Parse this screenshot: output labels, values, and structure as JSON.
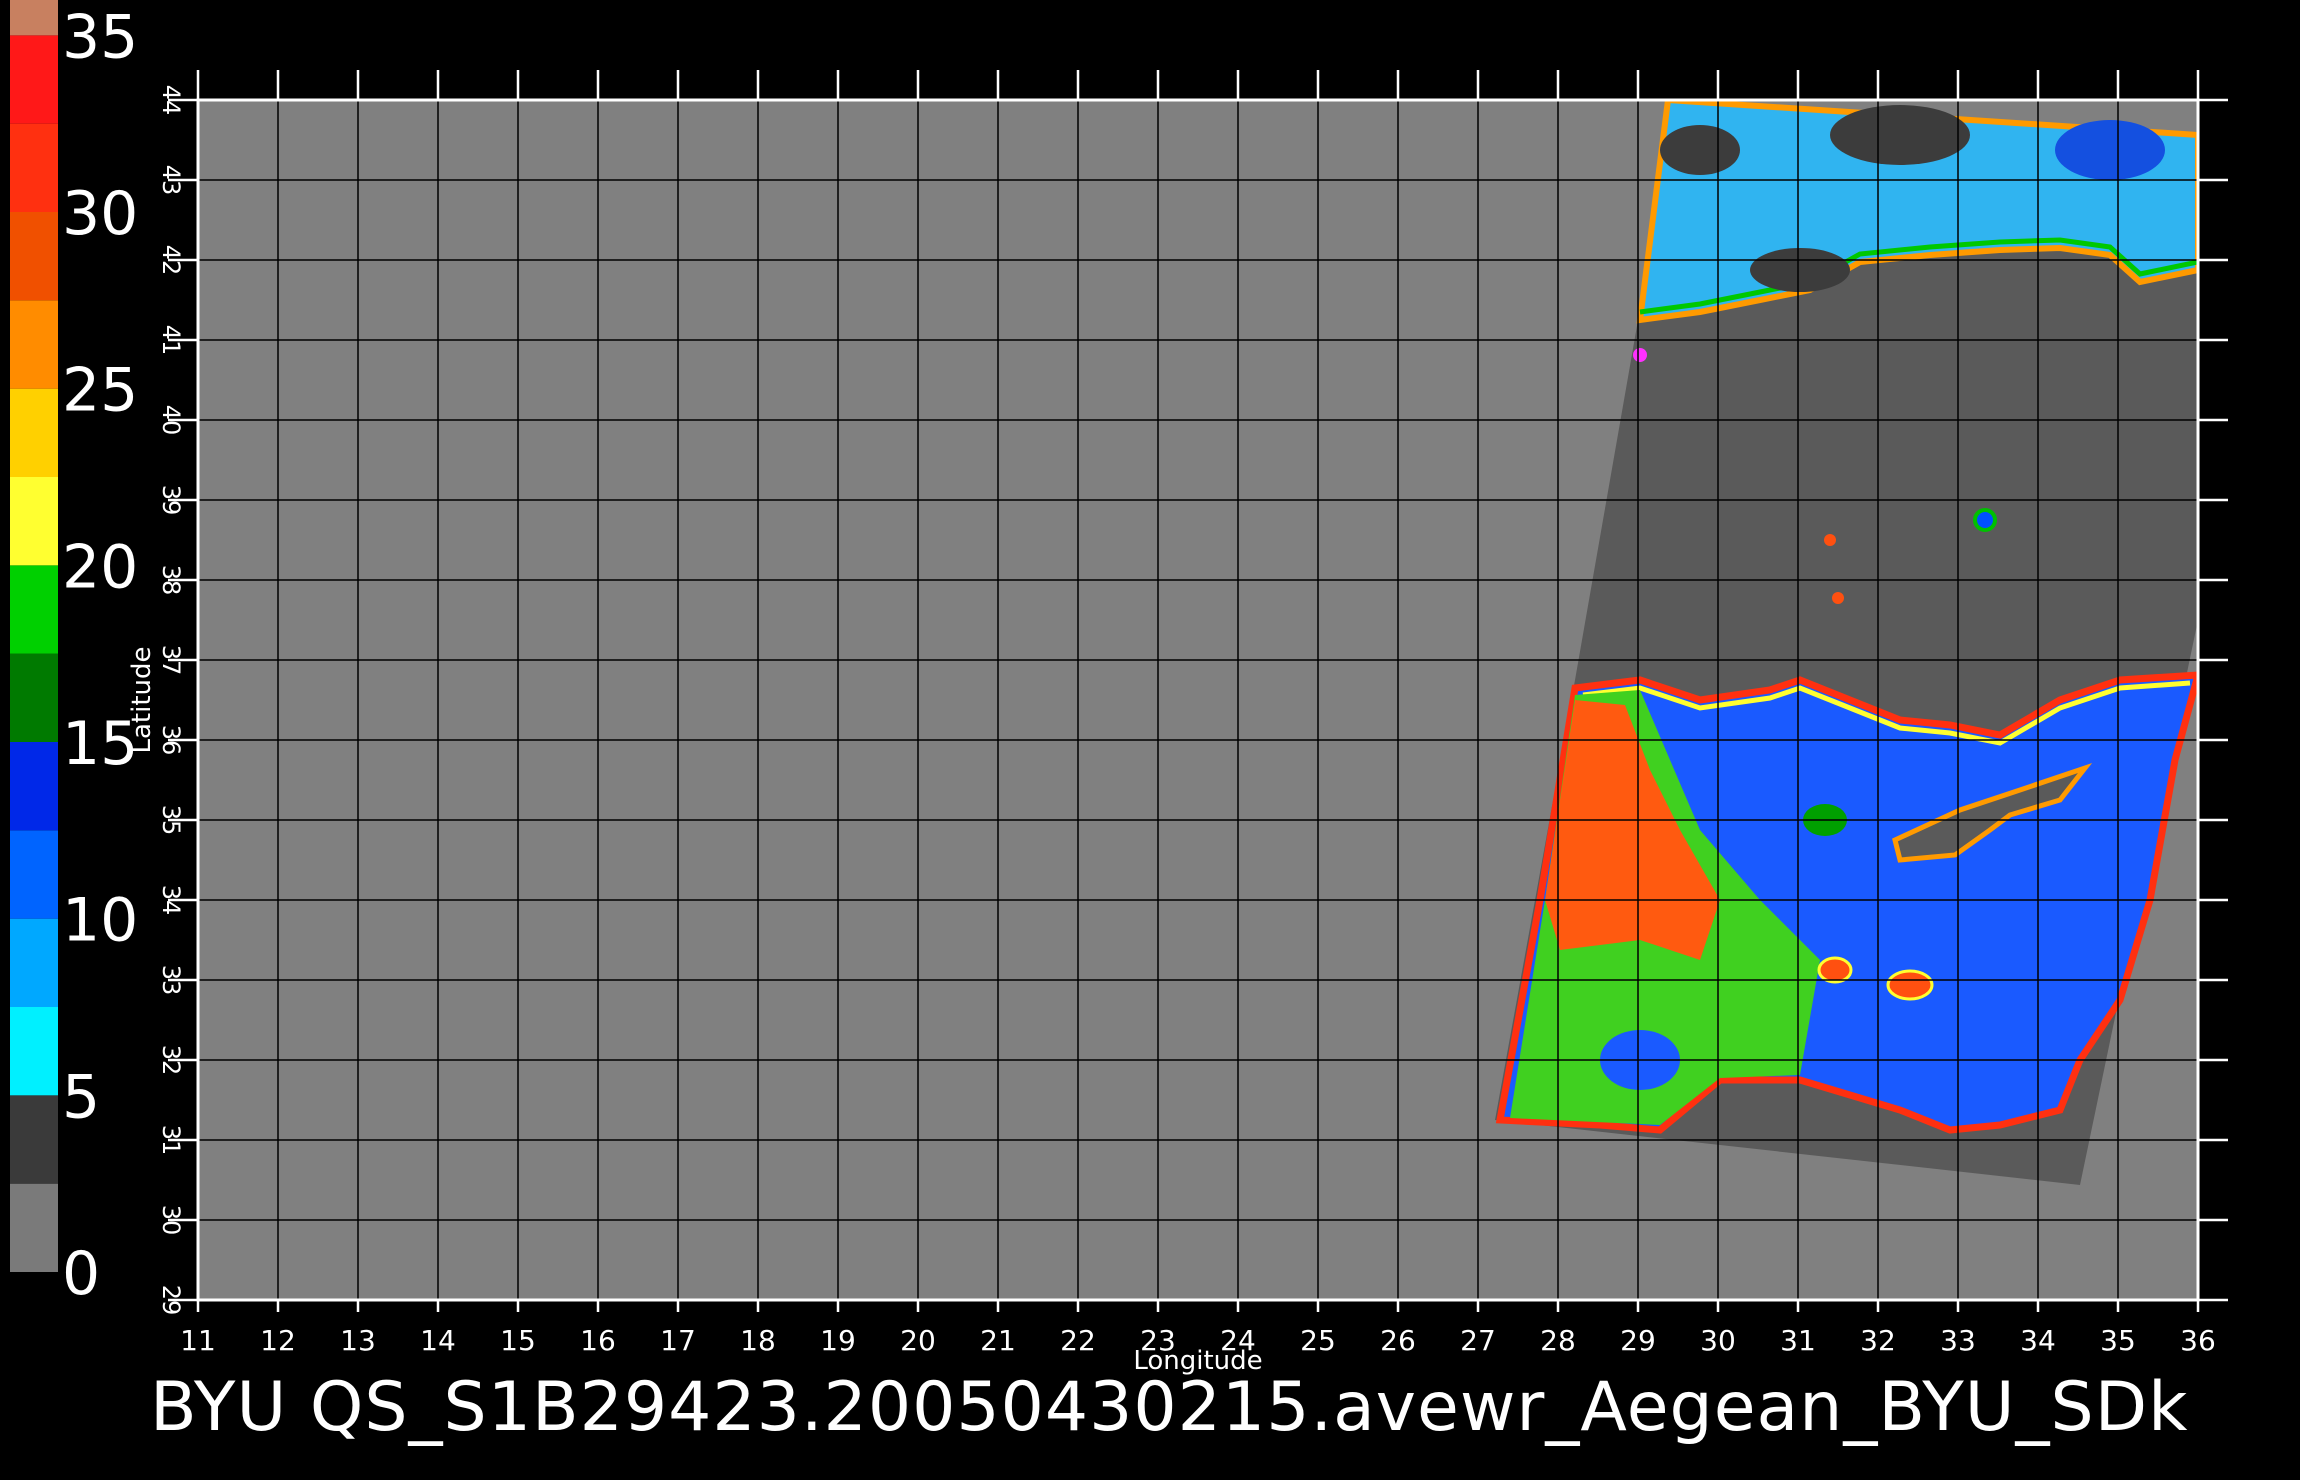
{
  "axes": {
    "xlabel": "Longitude",
    "ylabel": "Latitude",
    "lon_range": [
      11,
      36
    ],
    "lat_range": [
      29,
      44
    ],
    "lon_ticks": [
      "11",
      "12",
      "13",
      "14",
      "15",
      "16",
      "17",
      "18",
      "19",
      "20",
      "21",
      "22",
      "23",
      "24",
      "25",
      "26",
      "27",
      "28",
      "29",
      "30",
      "31",
      "32",
      "33",
      "34",
      "35",
      "36"
    ],
    "lat_ticks": [
      "29",
      "30",
      "31",
      "32",
      "33",
      "34",
      "35",
      "36",
      "37",
      "38",
      "39",
      "40",
      "41",
      "42",
      "43",
      "44"
    ]
  },
  "colorbar": {
    "labels": [
      "0",
      "5",
      "10",
      "15",
      "20",
      "25",
      "30",
      "35"
    ],
    "segments": [
      {
        "from": 0,
        "to": 2.5,
        "color": "#7a7a7a"
      },
      {
        "from": 2.5,
        "to": 5,
        "color": "#3a3a3a"
      },
      {
        "from": 5,
        "to": 7.5,
        "color": "#00f0ff"
      },
      {
        "from": 7.5,
        "to": 10,
        "color": "#00a8ff"
      },
      {
        "from": 10,
        "to": 12.5,
        "color": "#0064ff"
      },
      {
        "from": 12.5,
        "to": 15,
        "color": "#0028e8"
      },
      {
        "from": 15,
        "to": 17.5,
        "color": "#007a00"
      },
      {
        "from": 17.5,
        "to": 20,
        "color": "#00d000"
      },
      {
        "from": 20,
        "to": 22.5,
        "color": "#ffff30"
      },
      {
        "from": 22.5,
        "to": 25,
        "color": "#ffd000"
      },
      {
        "from": 25,
        "to": 27.5,
        "color": "#ff8c00"
      },
      {
        "from": 27.5,
        "to": 30,
        "color": "#f05000"
      },
      {
        "from": 30,
        "to": 32.5,
        "color": "#ff3010"
      },
      {
        "from": 32.5,
        "to": 35,
        "color": "#ff1818"
      },
      {
        "from": 35,
        "to": 36,
        "color": "#c88060"
      }
    ]
  },
  "colors": {
    "background": "#000000",
    "map_fill": "#808080",
    "swath_fill": "#5a5a5a",
    "grid": "#000000",
    "text": "#ffffff"
  },
  "caption": "BYU  QS_S1B29423.20050430215.avewr_Aegean_BYU_SDk"
}
